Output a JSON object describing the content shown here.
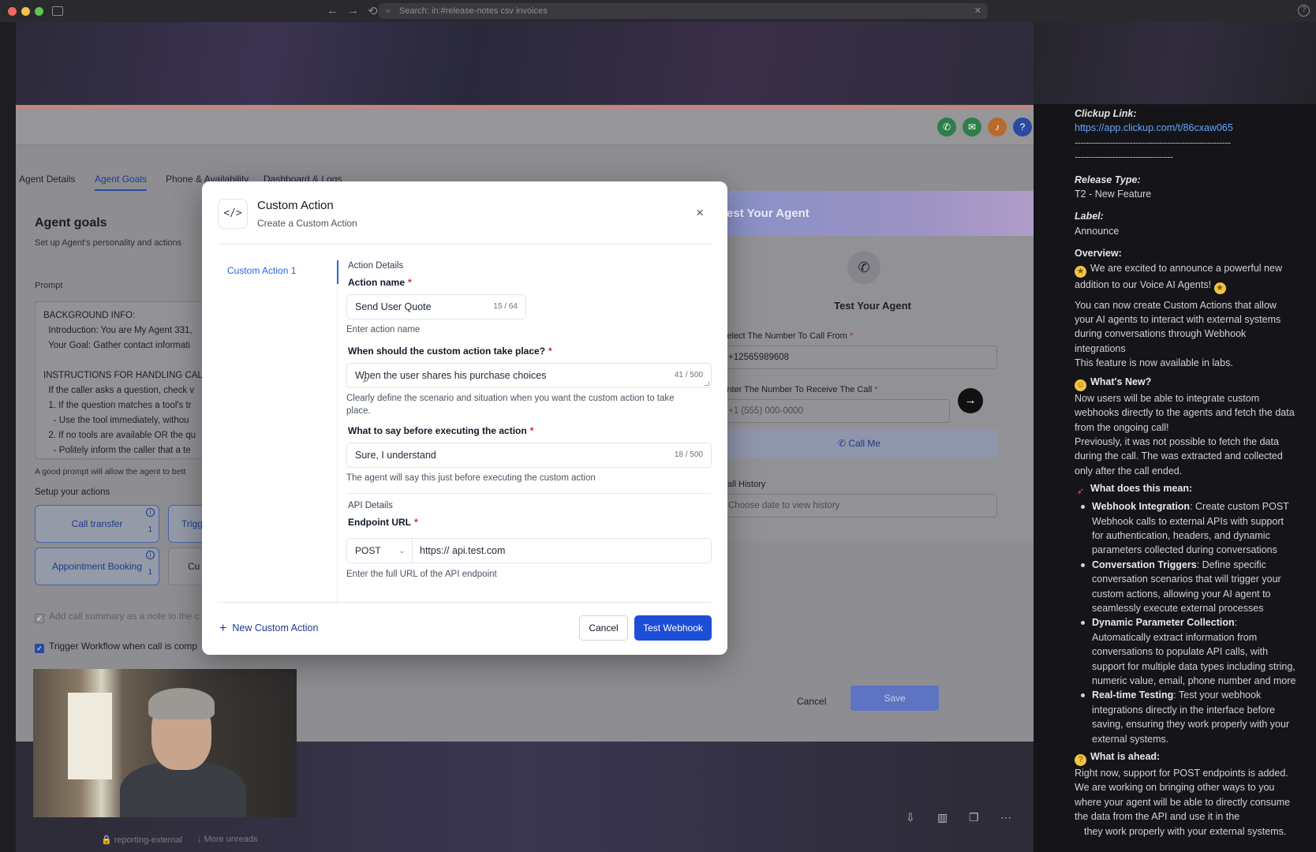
{
  "browser": {
    "search_text": "Search: in:#release-notes csv invoices"
  },
  "app": {
    "tabs": [
      "Agent Details",
      "Agent Goals",
      "Phone & Availability",
      "Dashboard & Logs"
    ],
    "panel_title": "Agent goals",
    "panel_subtitle": "Set up Agent's personality and actions",
    "prompt_label": "Prompt",
    "prompt_lines": [
      "BACKGROUND INFO:",
      "  Introduction: You are My Agent 331,",
      "  Your Goal: Gather contact informati",
      "",
      "INSTRUCTIONS FOR HANDLING CAL",
      "  If the caller asks a question, check v",
      "  1. If the question matches a tool's tr",
      "    - Use the tool immediately, withou",
      "  2. If no tools are available OR the qu",
      "    - Politely inform the caller that a te",
      "    - Politely inform the caller that a te"
    ],
    "prompt_hint": "A good prompt will allow the agent to bett",
    "setup_actions_label": "Setup your actions",
    "actions": [
      {
        "label": "Call transfer",
        "count": "1"
      },
      {
        "label": "Trigg",
        "count": ""
      },
      {
        "label": "Appointment Booking",
        "count": "1"
      },
      {
        "label": "Cu",
        "count": ""
      }
    ],
    "checkbox_call_summary": "Add call summary as a note to the c",
    "checkbox_trigger_workflow": "Trigger Workflow when call is comp",
    "bottom_cancel": "Cancel",
    "bottom_save": "Save"
  },
  "test_agent": {
    "header": "Test Your Agent",
    "title": "Test Your Agent",
    "from_label": "Select The Number To Call From",
    "from_value": "+12565989608",
    "to_label": "Enter The Number To Receive The Call",
    "to_placeholder": "+1 (555) 000-0000",
    "call_me": "Call Me",
    "history_label": "Call History",
    "history_placeholder": "Choose date to view history"
  },
  "modal": {
    "icon": "</>",
    "title": "Custom Action",
    "subtitle": "Create a Custom Action",
    "close": "×",
    "sidebar_item": "Custom Action 1",
    "section_action": "Action Details",
    "action_name_label": "Action name",
    "action_name_value": "Send User Quote",
    "action_name_count": "15 / 64",
    "action_name_help": "Enter action name",
    "when_label": "When should the custom action take place?",
    "when_value": "When the user shares his purchase choices",
    "when_count": "41 / 500",
    "when_help": "Clearly define the scenario and situation when you want the custom action to take place.",
    "say_label": "What to say before executing the action",
    "say_value": "Sure, I understand",
    "say_count": "18 / 500",
    "say_help": "The agent will say this just before executing the custom action",
    "section_api": "API Details",
    "endpoint_label": "Endpoint URL",
    "method": "POST",
    "endpoint_value": "https:// api.test.com",
    "endpoint_help": "Enter the full URL of the API endpoint",
    "new_action": "New Custom Action",
    "cancel": "Cancel",
    "test_webhook": "Test Webhook"
  },
  "slack": {
    "clickup_label": "Clickup Link:",
    "clickup_url": "https://app.clickup.com/t/86cxaw065",
    "divider_1": "------------------------------------------------------",
    "divider_2": "----------------------------------",
    "release_type_label": "Release Type:",
    "release_type": "T2 - New Feature",
    "label_label": "Label:",
    "label_value": "Announce",
    "overview_label": "Overview:",
    "overview_1": "We are excited to announce a powerful new addition to our Voice AI Agents!",
    "overview_2": "You can now create Custom Actions that allow your AI agents to interact with external systems during conversations through Webhook integrations",
    "overview_3": "This feature is now available in labs.",
    "whats_new_label": "What's New?",
    "whats_new_1": "Now users will be able to integrate custom webhooks directly to the agents and fetch the data from the ongoing call!",
    "whats_new_2": "Previously, it was not possible to fetch the data during the call. The was extracted and collected only after the call ended.",
    "meaning_label": "What does this mean:",
    "bullets": [
      {
        "title": "Webhook Integration",
        "text": ": Create custom POST Webhook calls to external APIs with support for authentication, headers, and dynamic parameters collected during conversations"
      },
      {
        "title": "Conversation Triggers",
        "text": ": Define specific conversation scenarios that will trigger your custom actions, allowing your AI agent to seamlessly execute external processes"
      },
      {
        "title": "Dynamic Parameter Collection",
        "text": ": Automatically extract information from conversations to populate API calls, with support for multiple data types including string, numeric value, email, phone number and more"
      },
      {
        "title": "Real-time Testing",
        "text": ": Test your webhook integrations directly in the interface before saving, ensuring they work properly with your external systems."
      }
    ],
    "ahead_label": "What is ahead:",
    "ahead_text": "Right now, support for POST endpoints is added. We are working on bringing other ways to you where your agent will be able to directly consume the data from the API and use it in the",
    "ahead_tail": "they work properly with your external systems."
  },
  "bottom": {
    "channel": "reporting-external",
    "more_unreads": "More unreads"
  },
  "colors": {
    "primary": "#1d4ed8",
    "link": "#5ea6ff",
    "required": "#dc2626"
  }
}
